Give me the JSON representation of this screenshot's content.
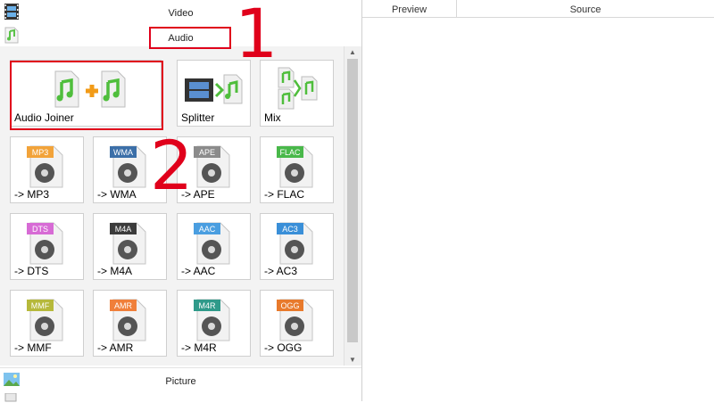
{
  "categories": {
    "video_label": "Video",
    "audio_label": "Audio",
    "picture_label": "Picture"
  },
  "tools": [
    {
      "label": "Audio Joiner",
      "icon": "audio-joiner-icon"
    },
    {
      "label": "Splitter",
      "icon": "splitter-icon"
    },
    {
      "label": "Mix",
      "icon": "mix-icon"
    }
  ],
  "formats": [
    {
      "label": "-> MP3",
      "badge": "MP3",
      "badge_color": "#f2a33a"
    },
    {
      "label": "-> WMA",
      "badge": "WMA",
      "badge_color": "#3c6fa8"
    },
    {
      "label": "-> APE",
      "badge": "APE",
      "badge_color": "#8b8b8b"
    },
    {
      "label": "-> FLAC",
      "badge": "FLAC",
      "badge_color": "#49b84a"
    },
    {
      "label": "-> DTS",
      "badge": "DTS",
      "badge_color": "#d76bd5"
    },
    {
      "label": "-> M4A",
      "badge": "M4A",
      "badge_color": "#3b3b3b"
    },
    {
      "label": "-> AAC",
      "badge": "AAC",
      "badge_color": "#4a9ee0"
    },
    {
      "label": "-> AC3",
      "badge": "AC3",
      "badge_color": "#3a8fd8"
    },
    {
      "label": "-> MMF",
      "badge": "MMF",
      "badge_color": "#b6b93b"
    },
    {
      "label": "-> AMR",
      "badge": "AMR",
      "badge_color": "#f07f3a"
    },
    {
      "label": "-> M4R",
      "badge": "M4R",
      "badge_color": "#2f9a8a"
    },
    {
      "label": "-> OGG",
      "badge": "OGG",
      "badge_color": "#e87a2c"
    }
  ],
  "columns": {
    "preview": "Preview",
    "source": "Source"
  },
  "annotations": {
    "step1": "1",
    "step2": "2"
  },
  "colors": {
    "annotation_red": "#e0001b",
    "note_green": "#5cc34a"
  }
}
